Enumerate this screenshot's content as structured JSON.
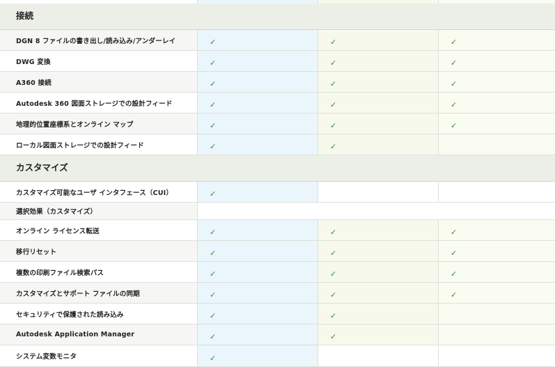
{
  "check_glyph": "✓",
  "sections": [
    {
      "title": "接続",
      "features": [
        {
          "label": "DGN 8 ファイルの書き出し/読み込み/アンダーレイ",
          "checks": [
            true,
            true,
            true
          ]
        },
        {
          "label": "DWG 変換",
          "checks": [
            true,
            true,
            true
          ]
        },
        {
          "label": "A360 接続",
          "checks": [
            true,
            true,
            true
          ]
        },
        {
          "label": "Autodesk 360 図面ストレージでの設計フィード",
          "checks": [
            true,
            true,
            true
          ]
        },
        {
          "label": "地理的位置座標系とオンライン マップ",
          "checks": [
            true,
            true,
            true
          ]
        },
        {
          "label": "ローカル図面ストレージでの設計フィード",
          "checks": [
            true,
            true,
            false
          ]
        }
      ]
    },
    {
      "title": "カスタマイズ",
      "features": [
        {
          "label": "カスタマイズ可能なユーザ インタフェース（CUI）",
          "checks": [
            true,
            false,
            false
          ]
        },
        {
          "label": "選択効果（カスタマイズ）",
          "checks": null
        },
        {
          "label": "オンライン ライセンス転送",
          "checks": [
            true,
            true,
            true
          ]
        },
        {
          "label": "移行リセット",
          "checks": [
            true,
            true,
            true
          ]
        },
        {
          "label": "複数の印刷ファイル検索パス",
          "checks": [
            true,
            true,
            true
          ]
        },
        {
          "label": "カスタマイズとサポート ファイルの同期",
          "checks": [
            true,
            true,
            true
          ]
        },
        {
          "label": "セキュリティで保護された読み込み",
          "checks": [
            true,
            true,
            false
          ]
        },
        {
          "label": "Autodesk Application Manager",
          "checks": [
            true,
            true,
            false
          ]
        },
        {
          "label": "システム変数モニタ",
          "checks": [
            true,
            false,
            false
          ]
        }
      ]
    }
  ]
}
